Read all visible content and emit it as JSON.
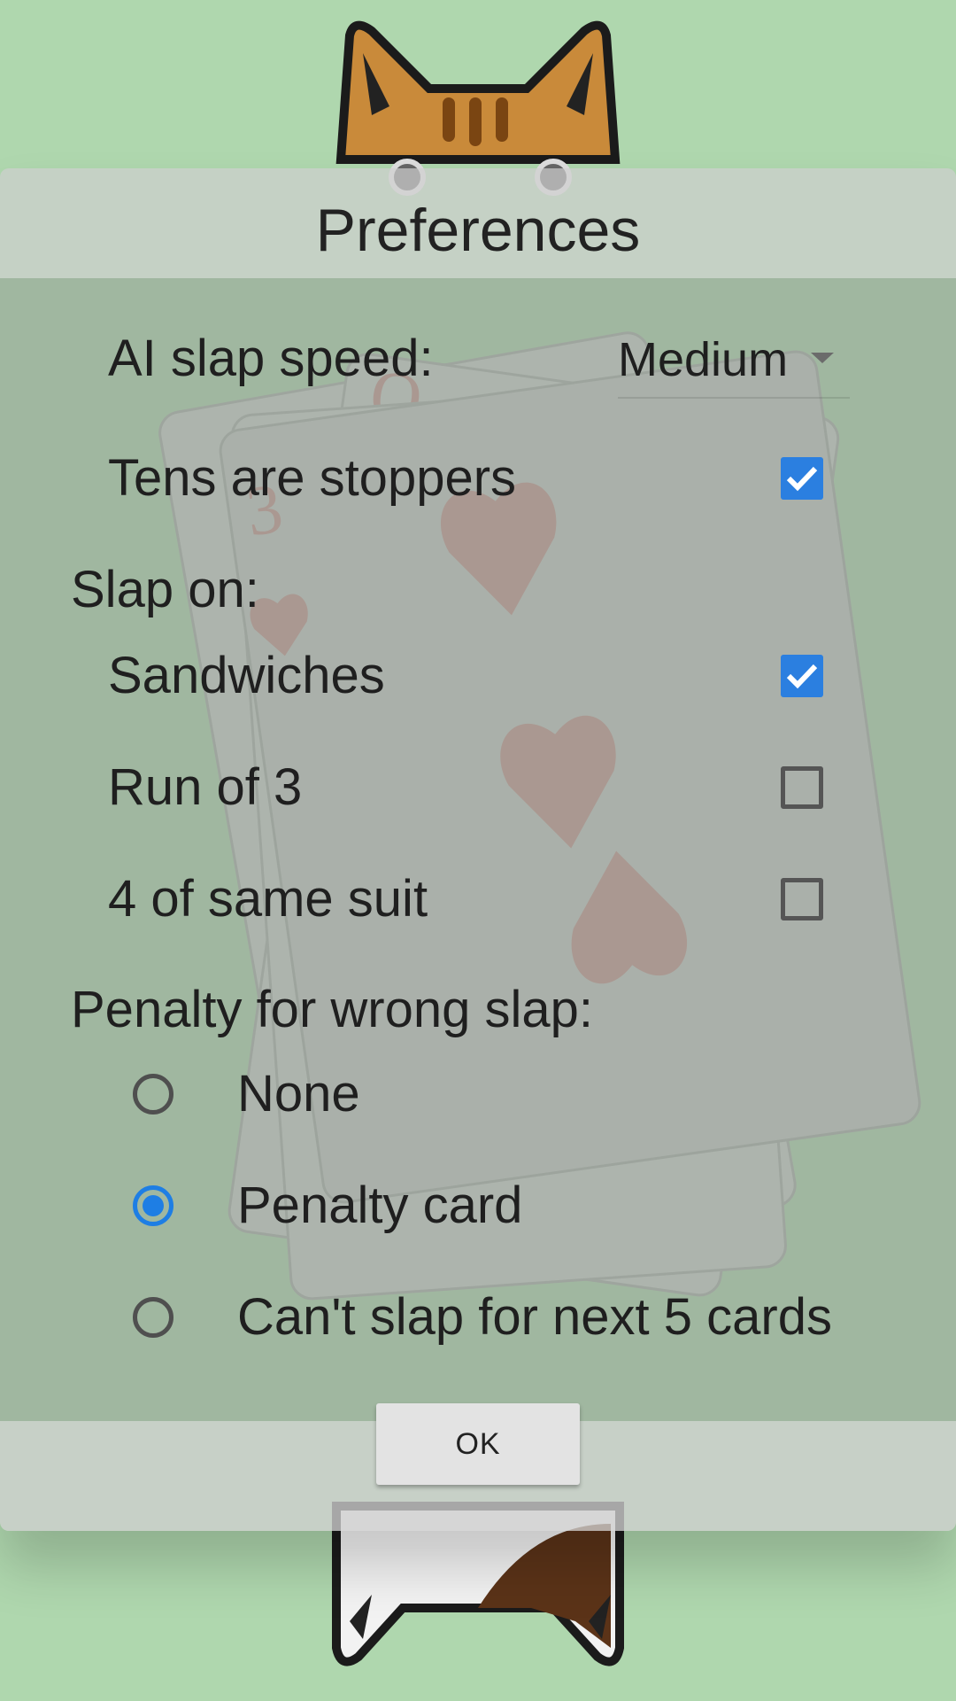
{
  "dialog": {
    "title": "Preferences",
    "ok_label": "OK"
  },
  "ai_slap_speed": {
    "label": "AI slap speed:",
    "value": "Medium"
  },
  "tens_are_stoppers": {
    "label": "Tens are stoppers",
    "checked": true
  },
  "slap_on": {
    "heading": "Slap on:",
    "options": [
      {
        "label": "Sandwiches",
        "checked": true
      },
      {
        "label": "Run of 3",
        "checked": false
      },
      {
        "label": "4 of same suit",
        "checked": false
      }
    ]
  },
  "penalty": {
    "heading": "Penalty for wrong slap:",
    "options": [
      {
        "label": "None",
        "selected": false
      },
      {
        "label": "Penalty card",
        "selected": true
      },
      {
        "label": "Can't slap for next 5 cards",
        "selected": false
      }
    ]
  },
  "colors": {
    "accent": "#2b7fe0",
    "background": "#afd7ae"
  }
}
